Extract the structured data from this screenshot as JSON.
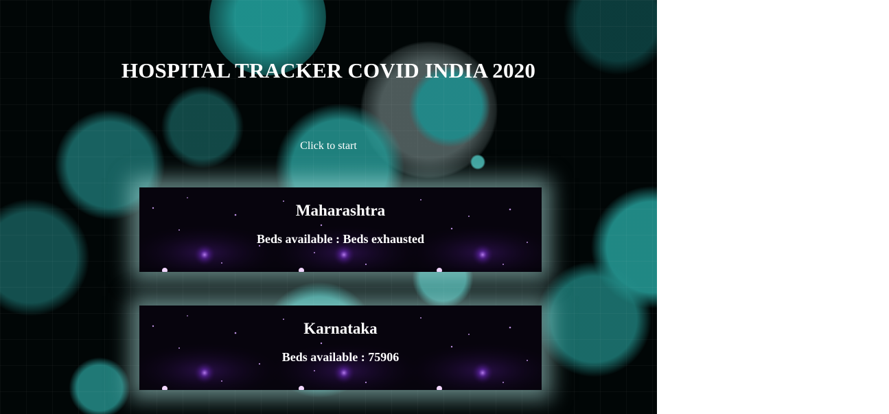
{
  "page": {
    "title": "HOSPITAL TRACKER COVID INDIA 2020",
    "start_link": "Click to start"
  },
  "states": [
    {
      "name": "Maharashtra",
      "beds_label": "Beds available : ",
      "beds_value": "Beds exhausted"
    },
    {
      "name": "Karnataka",
      "beds_label": "Beds available : ",
      "beds_value": "75906"
    }
  ],
  "colors": {
    "background": "#010606",
    "bokeh_teal": "#1f8f8c",
    "card_background": "#07040d",
    "card_glow": "#afe6e1",
    "star_purple": "#b36bff",
    "text": "#ffffff"
  }
}
